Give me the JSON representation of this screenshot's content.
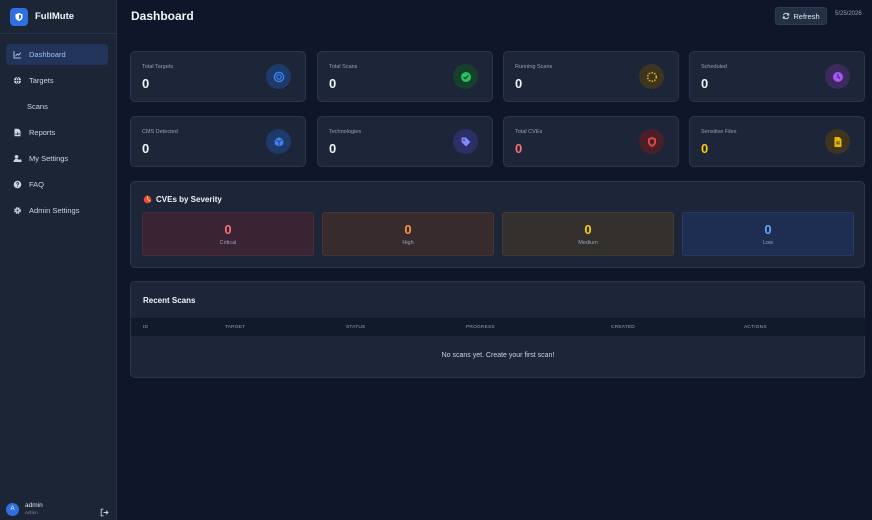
{
  "brand": {
    "name": "FullMute"
  },
  "sidebar": {
    "items": [
      {
        "label": "Dashboard"
      },
      {
        "label": "Targets"
      },
      {
        "label": "Scans"
      },
      {
        "label": "Reports"
      },
      {
        "label": "My Settings"
      },
      {
        "label": "FAQ"
      },
      {
        "label": "Admin Settings"
      }
    ],
    "user": {
      "initial": "A",
      "name": "admin",
      "role": "Admin"
    }
  },
  "header": {
    "title": "Dashboard",
    "refresh_label": "Refresh",
    "date": "5/25/2026"
  },
  "stats": [
    {
      "label": "Total Targets",
      "value": "0",
      "icon": "target-icon",
      "color": "#3b82f6"
    },
    {
      "label": "Total Scans",
      "value": "0",
      "icon": "check-circle-icon",
      "color": "#22c55e"
    },
    {
      "label": "Running Scans",
      "value": "0",
      "icon": "spinner-icon",
      "color": "#eab308"
    },
    {
      "label": "Scheduled",
      "value": "0",
      "icon": "clock-icon",
      "color": "#a855f7"
    },
    {
      "label": "CMS Detected",
      "value": "0",
      "icon": "cube-icon",
      "color": "#3b82f6"
    },
    {
      "label": "Technologies",
      "value": "0",
      "icon": "tag-icon",
      "color": "#818cf8"
    },
    {
      "label": "Total CVEs",
      "value": "0",
      "icon": "shield-icon",
      "color": "#ef4444"
    },
    {
      "label": "Sensitive Files",
      "value": "0",
      "icon": "file-icon",
      "color": "#eab308"
    }
  ],
  "severity": {
    "title": "CVEs by Severity",
    "levels": [
      {
        "label": "Critical",
        "value": "0",
        "color": "#f87171"
      },
      {
        "label": "High",
        "value": "0",
        "color": "#fb923c"
      },
      {
        "label": "Medium",
        "value": "0",
        "color": "#facc15"
      },
      {
        "label": "Low",
        "value": "0",
        "color": "#60a5fa"
      }
    ]
  },
  "recent_scans": {
    "title": "Recent Scans",
    "columns": [
      "ID",
      "TARGET",
      "STATUS",
      "PROGRESS",
      "CREATED",
      "ACTIONS"
    ],
    "empty_message": "No scans yet. Create your first scan!"
  }
}
